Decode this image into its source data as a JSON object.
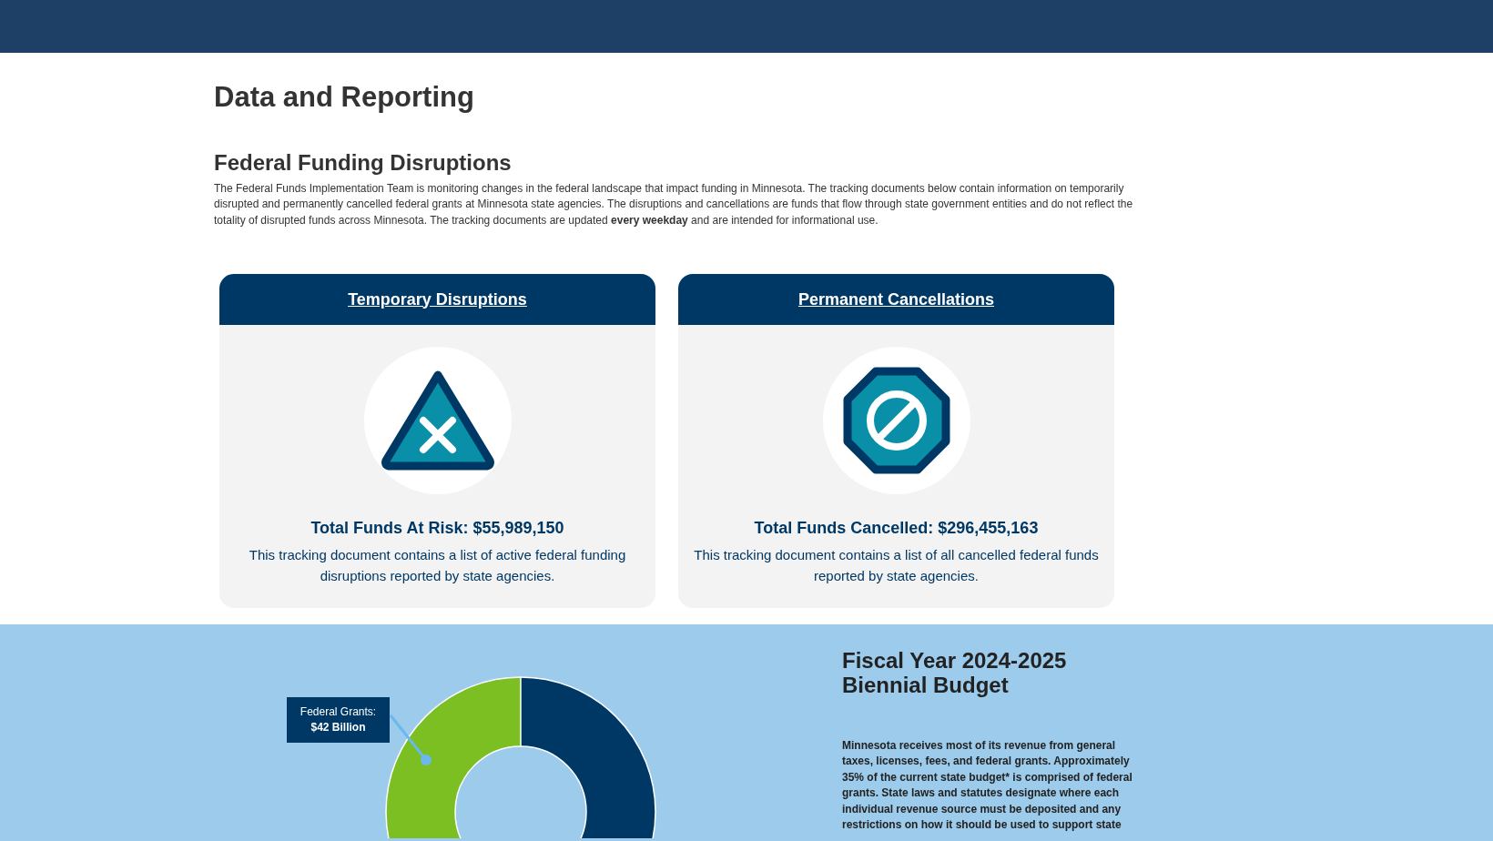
{
  "page_title": "Data and Reporting",
  "section": {
    "heading": "Federal Funding Disruptions",
    "intro": "The Federal Funds Implementation Team is monitoring changes in the federal landscape that impact funding in Minnesota. The tracking documents below contain information on temporarily disrupted and permanently cancelled federal grants at Minnesota state agencies. The disruptions and cancellations are funds that flow through state government entities and do not reflect the totality of disrupted funds across Minnesota. The tracking documents are updated **every weekday** and are intended for informational use."
  },
  "cards": [
    {
      "kind": "triangle",
      "title": "Temporary Disruptions",
      "total": "Total Funds At Risk: $55,989,150",
      "description": "This tracking document contains a list of active federal funding disruptions reported by state agencies."
    },
    {
      "kind": "octagon",
      "title": "Permanent Cancellations",
      "total": "Total Funds Cancelled: $296,455,163",
      "description": "This tracking document contains a list of all cancelled federal funds reported by state agencies."
    }
  ],
  "budget": {
    "callout_label": "Federal Grants:",
    "callout_value": "$42 Billion",
    "heading": "Fiscal Year 2024-2025 Biennial Budget",
    "body": "Minnesota receives most of its revenue from general taxes, licenses, fees, and federal grants. Approximately 35% of the current state budget* is comprised of federal grants. State laws and statutes designate where each individual revenue source must be deposited and any restrictions on how it should be used to support state"
  }
}
